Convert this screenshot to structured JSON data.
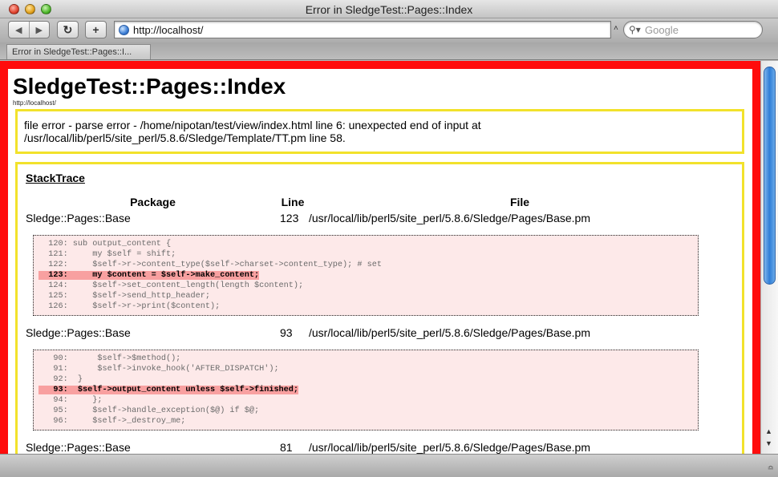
{
  "window": {
    "title": "Error in SledgeTest::Pages::Index"
  },
  "toolbar": {
    "back_icon": "back-arrow-icon",
    "forward_icon": "forward-arrow-icon",
    "reload_icon": "reload-icon",
    "add_icon": "plus-icon",
    "url": "http://localhost/",
    "search_placeholder": "Google"
  },
  "tabs": [
    {
      "label": "Error in SledgeTest::Pages::I..."
    }
  ],
  "page": {
    "heading": "SledgeTest::Pages::Index",
    "subtitle": "http://localhost/",
    "error_line1": "file error - parse error - /home/nipotan/test/view/index.html line 6: unexpected end of input at",
    "error_line2": "/usr/local/lib/perl5/site_perl/5.8.6/Sledge/Template/TT.pm line 58.",
    "stacktrace": {
      "title": "StackTrace",
      "headers": {
        "package": "Package",
        "line": "Line",
        "file": "File"
      },
      "frames": [
        {
          "package": "Sledge::Pages::Base",
          "line": "123",
          "file": "/usr/local/lib/perl5/site_perl/5.8.6/Sledge/Pages/Base.pm",
          "code": [
            {
              "text": "  120: sub output_content {",
              "hl": false
            },
            {
              "text": "  121:     my $self = shift;",
              "hl": false
            },
            {
              "text": "  122:     $self->r->content_type($self->charset->content_type); # set",
              "hl": false
            },
            {
              "text": "  123:     my $content = $self->make_content;",
              "hl": true
            },
            {
              "text": "  124:     $self->set_content_length(length $content);",
              "hl": false
            },
            {
              "text": "  125:     $self->send_http_header;",
              "hl": false
            },
            {
              "text": "  126:     $self->r->print($content);",
              "hl": false
            }
          ]
        },
        {
          "package": "Sledge::Pages::Base",
          "line": "93",
          "file": "/usr/local/lib/perl5/site_perl/5.8.6/Sledge/Pages/Base.pm",
          "code": [
            {
              "text": "   90:      $self->$method();",
              "hl": false
            },
            {
              "text": "   91:      $self->invoke_hook('AFTER_DISPATCH');",
              "hl": false
            },
            {
              "text": "   92:  }",
              "hl": false
            },
            {
              "text": "   93:  $self->output_content unless $self->finished;",
              "hl": true
            },
            {
              "text": "   94:     };",
              "hl": false
            },
            {
              "text": "   95:     $self->handle_exception($@) if $@;",
              "hl": false
            },
            {
              "text": "   96:     $self->_destroy_me;",
              "hl": false
            }
          ]
        },
        {
          "package": "Sledge::Pages::Base",
          "line": "81",
          "file": "/usr/local/lib/perl5/site_perl/5.8.6/Sledge/Pages/Base.pm",
          "code": []
        }
      ]
    }
  }
}
